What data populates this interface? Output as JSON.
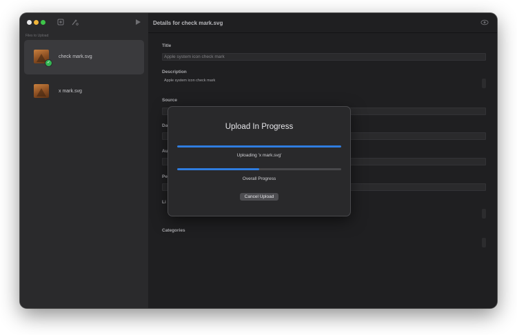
{
  "sidebar": {
    "section_label": "Files to Upload",
    "items": [
      {
        "label": "check mark.svg",
        "selected": true,
        "status": "uploaded"
      },
      {
        "label": "x mark.svg",
        "selected": false,
        "status": "pending"
      }
    ]
  },
  "toolbar": {
    "icons": [
      "add-file-icon",
      "wand-icon",
      "play-icon"
    ]
  },
  "main": {
    "title": "Details for check mark.svg",
    "fields": {
      "title": {
        "label": "Title",
        "placeholder": "Apple system icon check mark"
      },
      "description": {
        "label": "Description",
        "value": "Apple system icon check mark"
      },
      "source": {
        "label": "Source",
        "value": ""
      },
      "date": {
        "label": "Da",
        "value": ""
      },
      "author": {
        "label": "Au",
        "value": ""
      },
      "permission": {
        "label": "Pe",
        "value": ""
      },
      "license": {
        "label": "Li",
        "value": ""
      },
      "categories": {
        "label": "Categories",
        "value": ""
      }
    }
  },
  "dialog": {
    "title": "Upload In Progress",
    "file_progress": 1.0,
    "file_label": "Uploading 'x mark.svg'",
    "overall_progress": 0.5,
    "overall_label": "Overall Progress",
    "cancel_label": "Cancel Upload"
  },
  "colors": {
    "accent": "#2f7de0",
    "success": "#34b553",
    "window_bg": "#1e1e20",
    "sidebar_bg": "#2a2a2c"
  }
}
